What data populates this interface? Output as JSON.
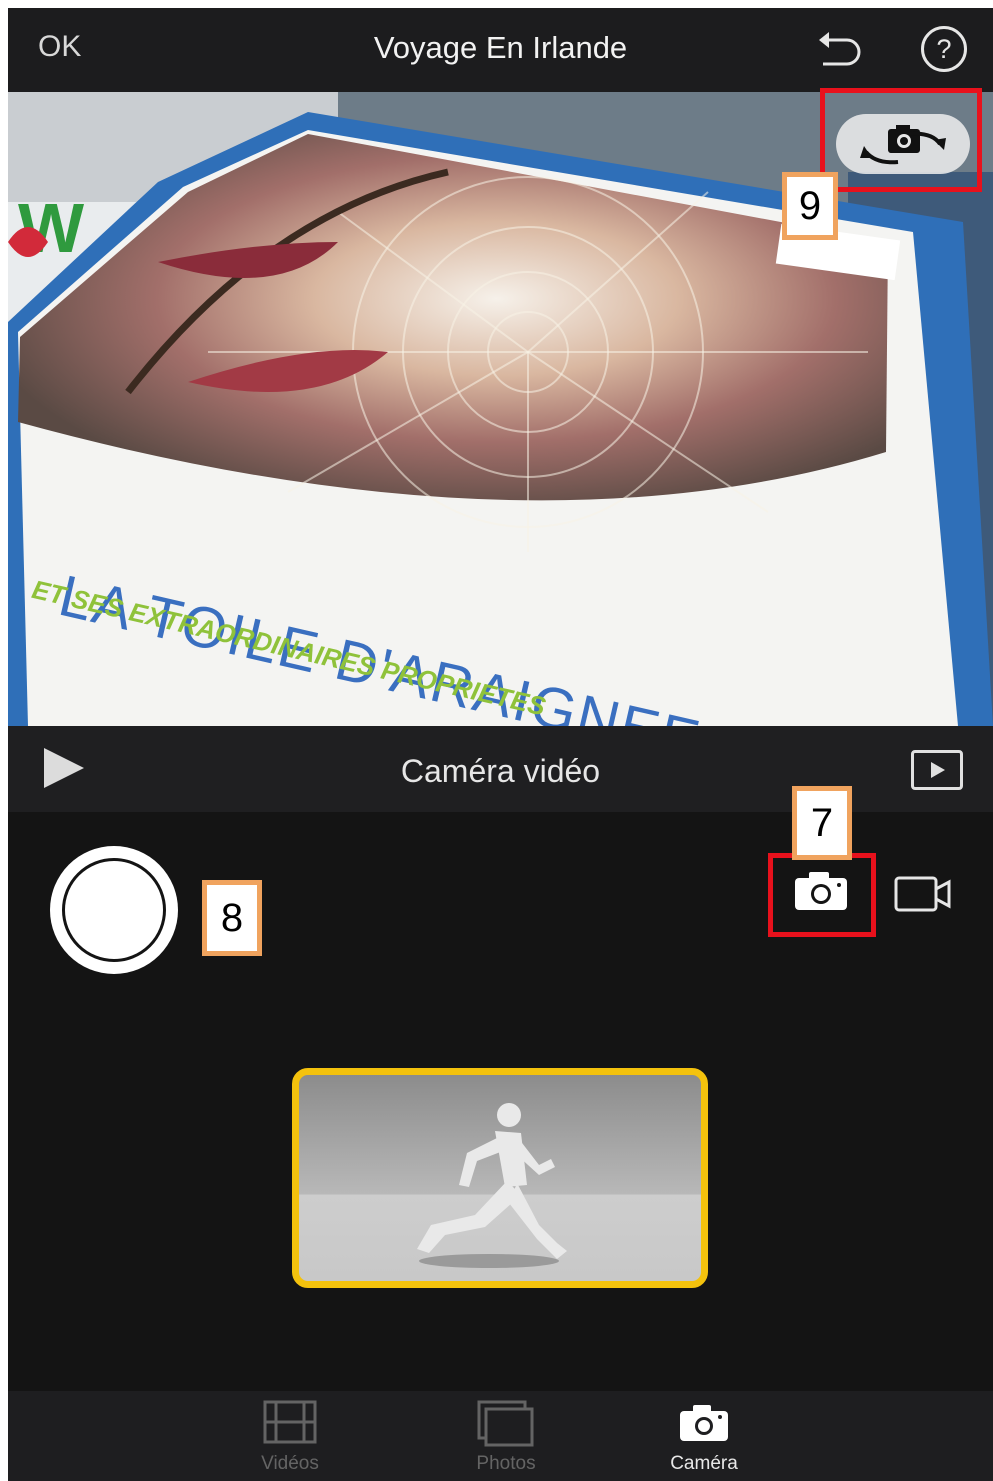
{
  "header": {
    "ok_label": "OK",
    "title": "Voyage En Irlande",
    "help_label": "?"
  },
  "preview": {
    "cover_title": "LA TOILE D'ARAIGNEE",
    "cover_subtitle": "ET SES EXTRAORDINAIRES PROPRIETES"
  },
  "mode_bar": {
    "label": "Caméra vidéo"
  },
  "annotations": {
    "label_7": "7",
    "label_8": "8",
    "label_9": "9"
  },
  "tabs": [
    {
      "label": "Vidéos",
      "icon": "film-icon",
      "active": false
    },
    {
      "label": "Photos",
      "icon": "photos-icon",
      "active": false
    },
    {
      "label": "Caméra",
      "icon": "camera-icon",
      "active": true
    }
  ],
  "colors": {
    "accent_yellow": "#f4c20d",
    "annotation_red": "#e8111c",
    "annotation_orange": "#f0a35e"
  }
}
